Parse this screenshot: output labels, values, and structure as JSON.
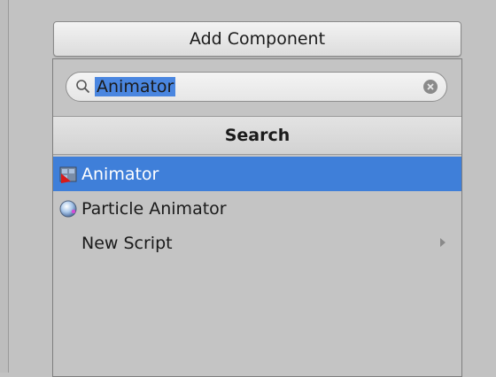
{
  "add_component": {
    "label": "Add Component"
  },
  "search": {
    "value": "Animator"
  },
  "popup": {
    "header": "Search"
  },
  "results": [
    {
      "label": "Animator",
      "icon": "animator-icon",
      "selected": true
    },
    {
      "label": "Particle Animator",
      "icon": "particle-animator-icon",
      "selected": false
    },
    {
      "label": "New Script",
      "icon": "none",
      "selected": false,
      "has_submenu": true
    }
  ],
  "colors": {
    "selection": "#3f7fd9",
    "panel": "#c4c4c4",
    "search_highlight": "#4a86e0"
  }
}
